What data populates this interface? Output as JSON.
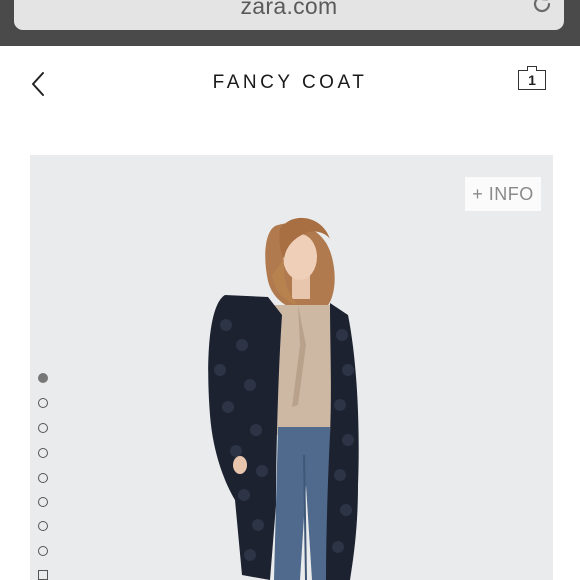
{
  "browser": {
    "url": "zara.com"
  },
  "header": {
    "title": "FANCY COAT",
    "cart_count": "1"
  },
  "product": {
    "info_label": "+ INFO",
    "gallery": {
      "total_slides": 9,
      "active_index": 0
    }
  },
  "colors": {
    "browser_chrome": "#4a4a4a",
    "url_field": "#e4e4e4",
    "image_background": "#eaebed",
    "coat": "#1c2230",
    "blouse": "#cdb8a4",
    "jeans": "#4f6a8c"
  }
}
